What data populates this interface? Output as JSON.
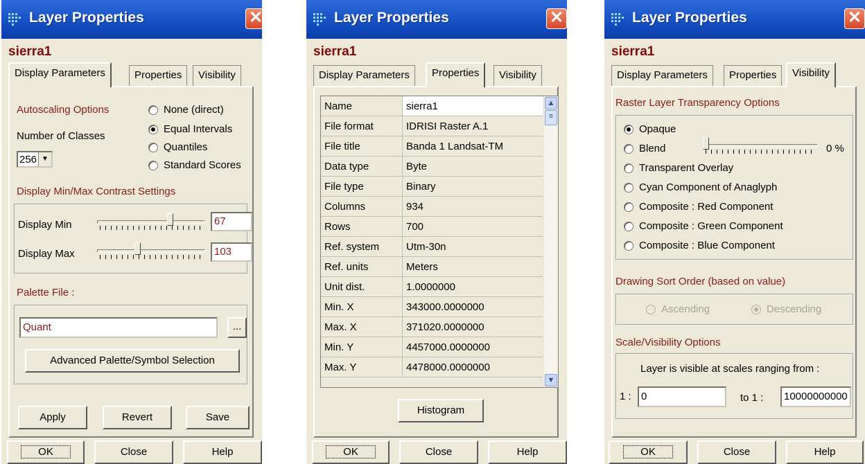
{
  "window_title": "Layer Properties",
  "close_glyph": "✕",
  "layer_name": "sierra1",
  "tabs": {
    "display": "Display Parameters",
    "properties": "Properties",
    "visibility": "Visibility"
  },
  "footer": {
    "ok": "OK",
    "close": "Close",
    "help": "Help"
  },
  "display_params": {
    "autoscaling_title": "Autoscaling Options",
    "number_of_classes_label": "Number of Classes",
    "number_of_classes_value": "256",
    "autoscaling_options": [
      "None (direct)",
      "Equal Intervals",
      "Quantiles",
      "Standard Scores"
    ],
    "autoscaling_selected": "Equal Intervals",
    "contrast_title": "Display Min/Max Contrast Settings",
    "display_min_label": "Display Min",
    "display_min_value": "67",
    "display_min_slider_fraction": 0.69,
    "display_max_label": "Display Max",
    "display_max_value": "103",
    "display_max_slider_fraction": 0.37,
    "palette_title": "Palette File :",
    "palette_value": "Quant",
    "browse_label": "...",
    "advanced_button": "Advanced Palette/Symbol Selection",
    "apply": "Apply",
    "revert": "Revert",
    "save": "Save"
  },
  "properties": {
    "rows": [
      {
        "key": "Name",
        "value": "sierra1"
      },
      {
        "key": "File format",
        "value": "IDRISI Raster A.1"
      },
      {
        "key": "File title",
        "value": "Banda 1 Landsat-TM"
      },
      {
        "key": "Data type",
        "value": "Byte"
      },
      {
        "key": "File type",
        "value": "Binary"
      },
      {
        "key": "Columns",
        "value": "934"
      },
      {
        "key": "Rows",
        "value": "700"
      },
      {
        "key": "Ref. system",
        "value": "Utm-30n"
      },
      {
        "key": "Ref. units",
        "value": "Meters"
      },
      {
        "key": "Unit dist.",
        "value": "1.0000000"
      },
      {
        "key": "Min. X",
        "value": "343000.0000000"
      },
      {
        "key": "Max. X",
        "value": "371020.0000000"
      },
      {
        "key": "Min. Y",
        "value": "4457000.0000000"
      },
      {
        "key": "Max. Y",
        "value": "4478000.0000000"
      }
    ],
    "histogram_button": "Histogram"
  },
  "visibility": {
    "transparency_title": "Raster Layer Transparency Options",
    "options": [
      "Opaque",
      "Blend",
      "Transparent Overlay",
      "Cyan Component of Anaglyph",
      "Composite : Red Component",
      "Composite : Green Component",
      "Composite : Blue Component"
    ],
    "selected": "Opaque",
    "blend_percent": "0 %",
    "blend_fraction": 0,
    "sort_title": "Drawing Sort Order (based on value)",
    "ascending": "Ascending",
    "descending": "Descending",
    "scale_title": "Scale/Visibility Options",
    "scale_text": "Layer is visible at scales ranging from :",
    "from_prefix": "1 :",
    "from_value": "0",
    "to_prefix": "to  1 :",
    "to_value": "10000000000"
  },
  "colors": {
    "title_bar": "#1a55c8",
    "section_text": "#8b1a1a",
    "dialog_bg": "#ece9d8",
    "close_button": "#d8462a"
  }
}
